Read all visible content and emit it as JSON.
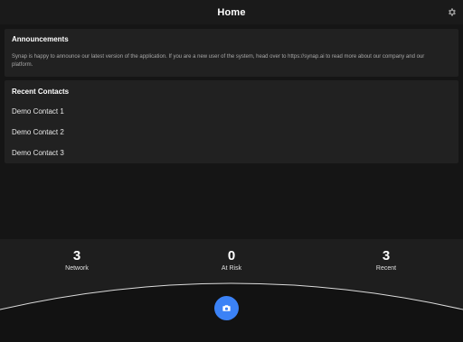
{
  "header": {
    "title": "Home",
    "settings_icon": "gear-icon"
  },
  "announcements": {
    "title": "Announcements",
    "text": "Synap is happy to announce our latest version of the application. If you are a new user of the system, head over to https://synap.ai to read more about our company and our platform."
  },
  "contacts": {
    "title": "Recent Contacts",
    "items": [
      {
        "label": "Demo Contact 1"
      },
      {
        "label": "Demo Contact 2"
      },
      {
        "label": "Demo Contact 3"
      }
    ]
  },
  "stats": {
    "network": {
      "value": "3",
      "label": "Network"
    },
    "at_risk": {
      "value": "0",
      "label": "At Risk"
    },
    "recent": {
      "value": "3",
      "label": "Recent"
    }
  },
  "action": {
    "icon": "camera-icon"
  },
  "colors": {
    "accent": "#3b82f6",
    "background": "#151515",
    "card": "#212121"
  }
}
